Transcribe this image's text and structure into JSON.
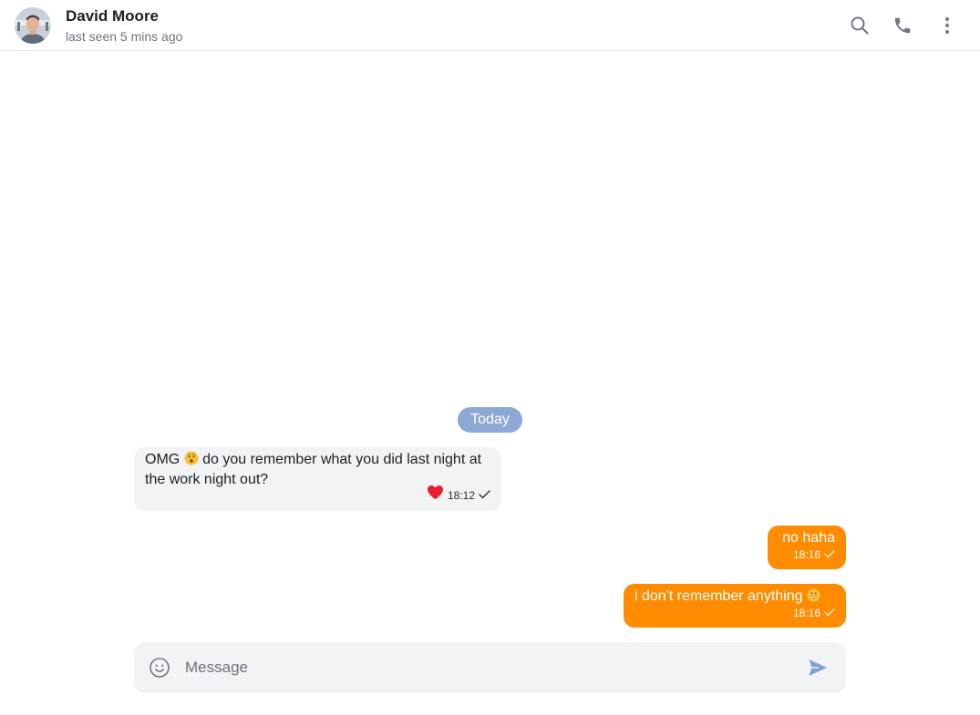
{
  "header": {
    "name": "David Moore",
    "status": "last seen 5 mins ago",
    "icons": [
      "search-icon",
      "phone-icon",
      "more-vertical-icon"
    ]
  },
  "date_separator": "Today",
  "messages": [
    {
      "direction": "incoming",
      "text_before_emoji": "OMG ",
      "emoji": "hushed-face",
      "text_after_emoji": " do you remember what you did last night at the work night out?",
      "reaction": "heart",
      "time": "18:12",
      "status": "sent"
    },
    {
      "direction": "outgoing",
      "text": "no haha",
      "time": "18:16",
      "status": "sent"
    },
    {
      "direction": "outgoing",
      "text": "i don't remember anything ",
      "emoji": "grinning-face",
      "time": "18:16",
      "status": "sent"
    }
  ],
  "composer": {
    "placeholder": "Message",
    "value": ""
  },
  "colors": {
    "accent": "#ff8c00",
    "date_pill": "#8ea8d6",
    "incoming_bubble": "#f2f3f5",
    "heart": "#e8202e",
    "send": "#7f9fd6"
  }
}
